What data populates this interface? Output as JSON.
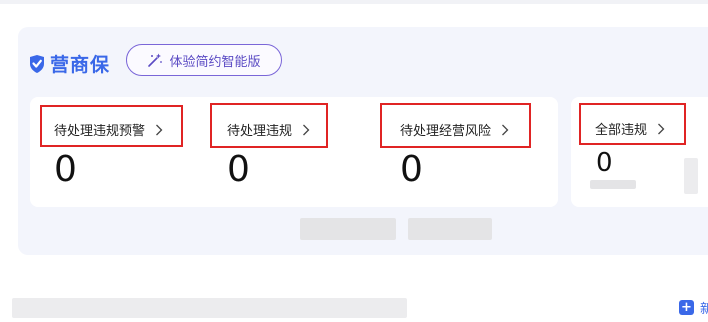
{
  "brand": {
    "name": "营商保"
  },
  "experience_button": {
    "label": "体验简约智能版",
    "icon": "sparkle-wand-icon"
  },
  "stats": [
    {
      "title": "待处理违规预警",
      "value": "0"
    },
    {
      "title": "待处理违规",
      "value": "0"
    },
    {
      "title": "待处理经营风险",
      "value": "0"
    },
    {
      "title": "全部违规",
      "value": "0"
    }
  ],
  "footer": {
    "add_label": "新"
  },
  "colors": {
    "accent": "#3a68e8",
    "purple": "#7a66d8",
    "highlight": "#e02424",
    "panel": "#f3f5fc"
  }
}
